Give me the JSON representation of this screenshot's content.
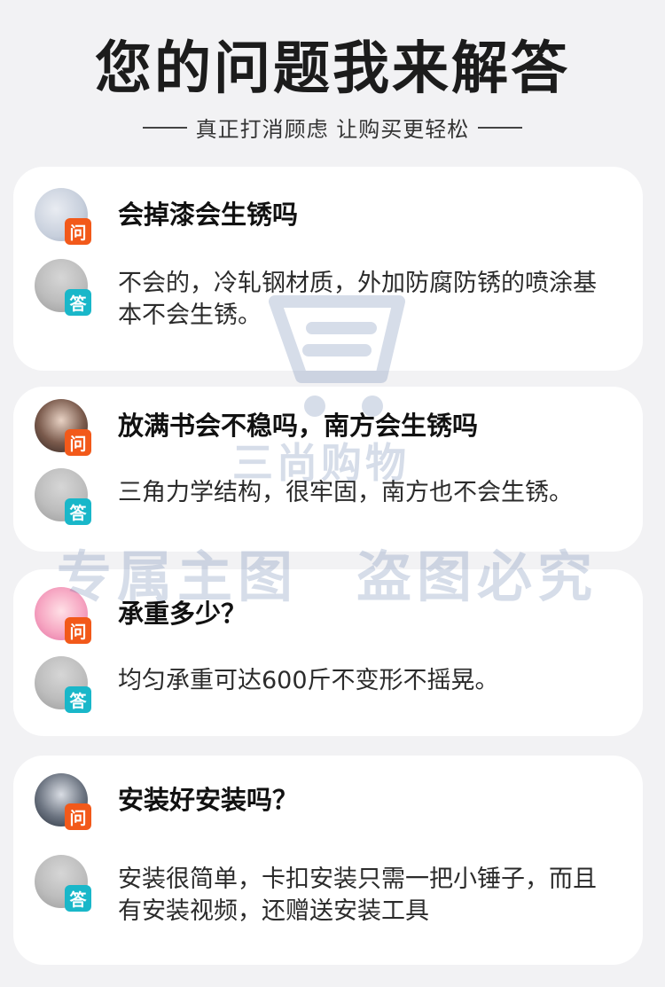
{
  "header": {
    "title": "您的问题我来解答",
    "subtitle": "真正打消顾虑 让购买更轻松"
  },
  "badges": {
    "question": "问",
    "answer": "答"
  },
  "qa": [
    {
      "question": "会掉漆会生锈吗",
      "answer": "不会的，冷轧钢材质，外加防腐防锈的喷涂基本不会生锈。"
    },
    {
      "question": "放满书会不稳吗，南方会生锈吗",
      "answer": "三角力学结构，很牢固，南方也不会生锈。"
    },
    {
      "question": "承重多少？",
      "answer": "均匀承重可达600斤不变形不摇晃。"
    },
    {
      "question": "安装好安装吗？",
      "answer": "安装很简单，卡扣安装只需一把小锤子，而且有安装视频，还赠送安装工具"
    }
  ],
  "watermark": {
    "brand": "三尚购物",
    "left": "专属主图",
    "right": "盗图必究"
  },
  "colors": {
    "question_badge": "#f2591a",
    "answer_badge": "#19b7c9",
    "card_bg": "#ffffff",
    "page_bg": "#f2f2f4"
  }
}
